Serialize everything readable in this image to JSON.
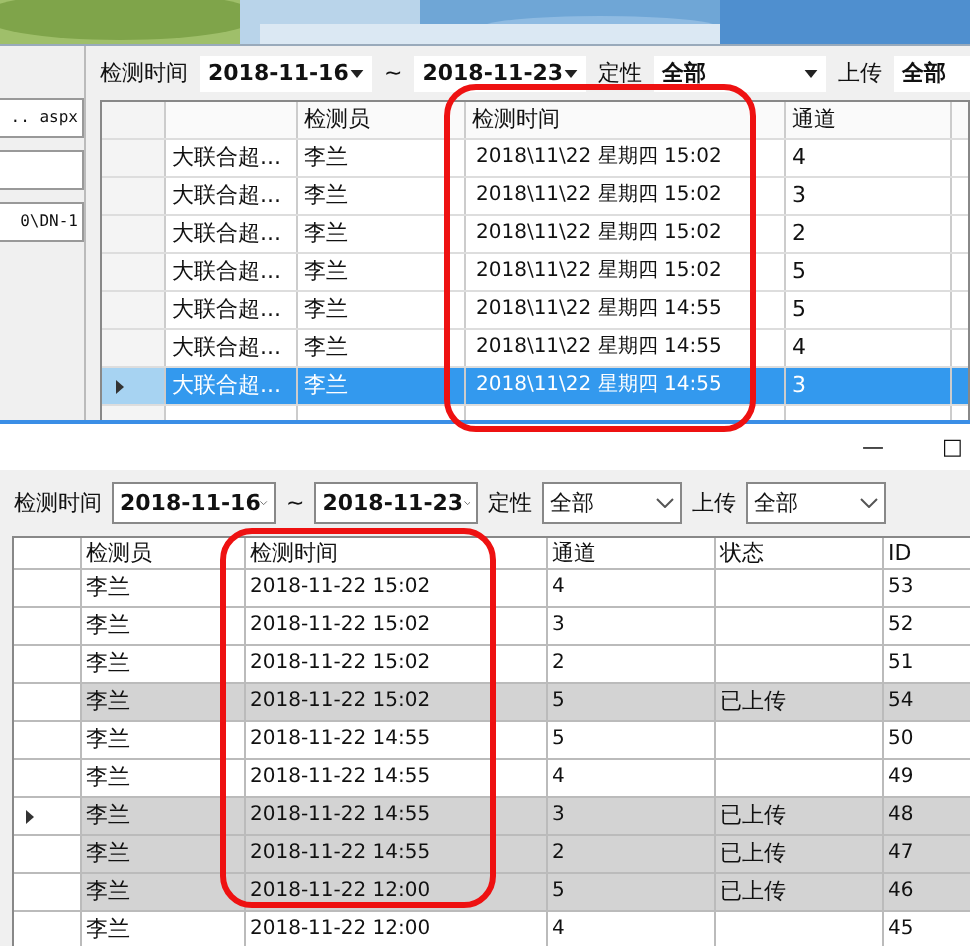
{
  "top_window": {
    "side_fields": [
      {
        "kind": "field",
        "value": ".. aspx"
      },
      {
        "kind": "field"
      },
      {
        "kind": "field",
        "value": "0\\DN-1"
      }
    ],
    "filters": [
      {
        "kind": "label",
        "text": "检测时间"
      },
      {
        "kind": "dropdown",
        "value": "2018-11-16"
      },
      {
        "kind": "label",
        "text": "~"
      },
      {
        "kind": "dropdown",
        "value": "2018-11-23"
      },
      {
        "kind": "label",
        "text": "定性"
      },
      {
        "kind": "dropdown",
        "value": "全部"
      },
      {
        "kind": "label",
        "text": "上传"
      },
      {
        "kind": "dropdown",
        "value": "全部"
      }
    ],
    "columns": [
      "",
      "检测员",
      "检测时间",
      "通道"
    ],
    "rows": [
      {
        "cells": [
          "大联合超...",
          "李兰",
          "2018\\11\\22 星期四 15:02",
          "4"
        ],
        "selected": false
      },
      {
        "cells": [
          "大联合超...",
          "李兰",
          "2018\\11\\22 星期四 15:02",
          "3"
        ],
        "selected": false
      },
      {
        "cells": [
          "大联合超...",
          "李兰",
          "2018\\11\\22 星期四 15:02",
          "2"
        ],
        "selected": false
      },
      {
        "cells": [
          "大联合超...",
          "李兰",
          "2018\\11\\22 星期四 15:02",
          "5"
        ],
        "selected": false
      },
      {
        "cells": [
          "大联合超...",
          "李兰",
          "2018\\11\\22 星期四 14:55",
          "5"
        ],
        "selected": false
      },
      {
        "cells": [
          "大联合超...",
          "李兰",
          "2018\\11\\22 星期四 14:55",
          "4"
        ],
        "selected": false
      },
      {
        "cells": [
          "大联合超...",
          "李兰",
          "2018\\11\\22 星期四 14:55",
          "3"
        ],
        "selected": true
      }
    ]
  },
  "bottom_window": {
    "controls": [
      "—",
      "□"
    ],
    "filters": [
      {
        "kind": "label",
        "text": "检测时间"
      },
      {
        "kind": "dropdown",
        "value": "2018-11-16"
      },
      {
        "kind": "label",
        "text": "~"
      },
      {
        "kind": "dropdown",
        "value": "2018-11-23"
      },
      {
        "kind": "label",
        "text": "定性"
      },
      {
        "kind": "dropdown",
        "value": "全部"
      },
      {
        "kind": "label",
        "text": "上传"
      },
      {
        "kind": "dropdown",
        "value": "全部"
      }
    ],
    "columns": [
      "检测员",
      "检测时间",
      "通道",
      "状态",
      "ID"
    ],
    "rows": [
      {
        "cells": [
          "李兰",
          "2018-11-22 15:02",
          "4",
          "",
          "53"
        ],
        "highlighted": false,
        "current": false
      },
      {
        "cells": [
          "李兰",
          "2018-11-22 15:02",
          "3",
          "",
          "52"
        ],
        "highlighted": false,
        "current": false
      },
      {
        "cells": [
          "李兰",
          "2018-11-22 15:02",
          "2",
          "",
          "51"
        ],
        "highlighted": false,
        "current": false
      },
      {
        "cells": [
          "李兰",
          "2018-11-22 15:02",
          "5",
          "已上传",
          "54"
        ],
        "highlighted": true,
        "current": false
      },
      {
        "cells": [
          "李兰",
          "2018-11-22 14:55",
          "5",
          "",
          "50"
        ],
        "highlighted": false,
        "current": false
      },
      {
        "cells": [
          "李兰",
          "2018-11-22 14:55",
          "4",
          "",
          "49"
        ],
        "highlighted": false,
        "current": false
      },
      {
        "cells": [
          "李兰",
          "2018-11-22 14:55",
          "3",
          "已上传",
          "48"
        ],
        "highlighted": true,
        "current": true
      },
      {
        "cells": [
          "李兰",
          "2018-11-22 14:55",
          "2",
          "已上传",
          "47"
        ],
        "highlighted": true,
        "current": false
      },
      {
        "cells": [
          "李兰",
          "2018-11-22 12:00",
          "5",
          "已上传",
          "46"
        ],
        "highlighted": true,
        "current": false
      },
      {
        "cells": [
          "李兰",
          "2018-11-22 12:00",
          "4",
          "",
          "45"
        ],
        "highlighted": false,
        "current": false
      }
    ]
  }
}
